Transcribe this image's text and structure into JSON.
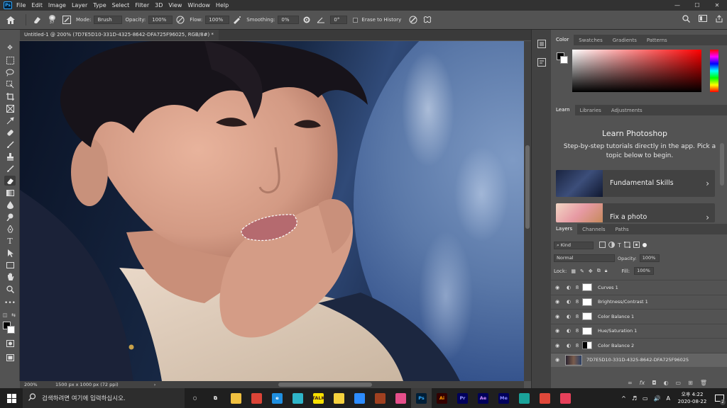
{
  "app": {
    "logo": "Ps"
  },
  "menu": [
    "File",
    "Edit",
    "Image",
    "Layer",
    "Type",
    "Select",
    "Filter",
    "3D",
    "View",
    "Window",
    "Help"
  ],
  "window_controls": [
    "—",
    "☐",
    "✕"
  ],
  "options": {
    "brush_size": "37",
    "mode_label": "Mode:",
    "mode_value": "Brush",
    "opacity_label": "Opacity:",
    "opacity_value": "100%",
    "flow_label": "Flow:",
    "flow_value": "100%",
    "smoothing_label": "Smoothing:",
    "smoothing_value": "0%",
    "angle_value": "0°",
    "erase_history_label": "Erase to History"
  },
  "document_tab": {
    "title": "Untitled-1 @ 200% (7D7E5D10-331D-4325-8642-DFA725F96025, RGB/8#) *",
    "close": "×"
  },
  "status": {
    "zoom": "200%",
    "doc_info": "1500 px x 1000 px (72 ppi)",
    "arrow": "›"
  },
  "color_panel": {
    "tabs": [
      "Color",
      "Swatches",
      "Gradients",
      "Patterns"
    ],
    "active_tab": 0
  },
  "learn_panel": {
    "tabs": [
      "Learn",
      "Libraries",
      "Adjustments"
    ],
    "active_tab": 0,
    "title": "Learn Photoshop",
    "description": "Step-by-step tutorials directly in the app. Pick a topic below to begin.",
    "cards": [
      {
        "title": "Fundamental Skills"
      },
      {
        "title": "Fix a photo"
      }
    ]
  },
  "layers_panel": {
    "tabs": [
      "Layers",
      "Channels",
      "Paths"
    ],
    "active_tab": 0,
    "filter_kind": "Kind",
    "blend_mode": "Normal",
    "opacity_label": "Opacity:",
    "opacity_value": "100%",
    "lock_label": "Lock:",
    "fill_label": "Fill:",
    "fill_value": "100%",
    "layers": [
      {
        "name": "Curves 1",
        "type": "adjustment",
        "mask": "white"
      },
      {
        "name": "Brightness/Contrast 1",
        "type": "adjustment",
        "mask": "white"
      },
      {
        "name": "Color Balance 1",
        "type": "adjustment",
        "mask": "white"
      },
      {
        "name": "Hue/Saturation 1",
        "type": "adjustment",
        "mask": "white"
      },
      {
        "name": "Color Balance 2",
        "type": "adjustment",
        "mask": "half"
      },
      {
        "name": "7D7E5D10-331D-4325-8642-DFA725F96025",
        "type": "pixel",
        "selected": true
      }
    ],
    "footer_icons": [
      "link-icon",
      "fx-icon",
      "mask-icon",
      "adjustment-icon",
      "folder-icon",
      "new-layer-icon",
      "trash-icon"
    ]
  },
  "taskbar": {
    "search_placeholder": "검색하려면 여기에 입력하십시오.",
    "apps": [
      {
        "name": "cortana-icon",
        "label": "○",
        "bg": "transparent",
        "fg": "#ffffff"
      },
      {
        "name": "task-view-icon",
        "label": "⧉",
        "bg": "transparent",
        "fg": "#ffffff"
      },
      {
        "name": "file-explorer-icon",
        "label": "",
        "bg": "#f0c040",
        "fg": "#000000"
      },
      {
        "name": "chrome-icon",
        "label": "",
        "bg": "#db4437",
        "fg": "#ffffff"
      },
      {
        "name": "edge-icon",
        "label": "e",
        "bg": "#1f8fe0",
        "fg": "#ffffff"
      },
      {
        "name": "bird-app-icon",
        "label": "",
        "bg": "#2fb5c9",
        "fg": "#ffffff"
      },
      {
        "name": "kakaotalk-icon",
        "label": "TALK",
        "bg": "#f9e000",
        "fg": "#3c1e1e"
      },
      {
        "name": "sticky-notes-icon",
        "label": "",
        "bg": "#f6d23e",
        "fg": "#000000"
      },
      {
        "name": "zoom-icon",
        "label": "",
        "bg": "#2d8cff",
        "fg": "#ffffff"
      },
      {
        "name": "game-icon",
        "label": "",
        "bg": "#a04020",
        "fg": "#ffffff"
      },
      {
        "name": "browser-app-icon",
        "label": "",
        "bg": "#e64f8a",
        "fg": "#ffffff"
      },
      {
        "name": "photoshop-icon",
        "label": "Ps",
        "bg": "#001e36",
        "fg": "#31a8ff"
      },
      {
        "name": "illustrator-icon",
        "label": "Ai",
        "bg": "#330000",
        "fg": "#ff9a00"
      },
      {
        "name": "premiere-icon",
        "label": "Pr",
        "bg": "#00005b",
        "fg": "#9999ff"
      },
      {
        "name": "after-effects-icon",
        "label": "Ae",
        "bg": "#00005b",
        "fg": "#d291ff"
      },
      {
        "name": "media-encoder-icon",
        "label": "Me",
        "bg": "#00005b",
        "fg": "#8c8cff"
      },
      {
        "name": "teal-app-icon",
        "label": "",
        "bg": "#1aa39a",
        "fg": "#ffffff"
      },
      {
        "name": "red-app-icon",
        "label": "",
        "bg": "#e0483a",
        "fg": "#ffffff"
      },
      {
        "name": "pink-app-icon",
        "label": "",
        "bg": "#e6405a",
        "fg": "#ffffff"
      }
    ],
    "tray_icons": [
      "^",
      "♬",
      "▭",
      "🔊",
      "A"
    ],
    "time": "오후 4:22",
    "date": "2020-08-22",
    "notifications": "2"
  }
}
